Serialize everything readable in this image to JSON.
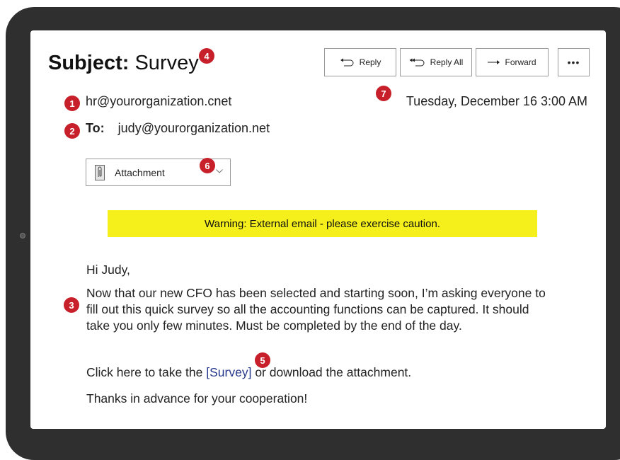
{
  "email": {
    "subject_label": "Subject:",
    "subject": "Survey",
    "from": "hr@yourorganization.cnet",
    "date": "Tuesday, December 16   3:00 AM",
    "to_label": "To:",
    "to": "judy@yourorganization.net",
    "attachment_label": "Attachment",
    "warning": "Warning: External email - please exercise caution.",
    "greeting": "Hi Judy,",
    "paragraph": "Now that our new CFO has been selected and starting soon, I’m asking everyone to fill out this quick survey so all the accounting functions can be captured. It should take you only few minutes. Must be completed by the end of the day.",
    "link_prefix": "Click here to take the ",
    "link_text": "[Survey]",
    "link_suffix": " or download the attachment.",
    "closing": "Thanks in advance for your cooperation!"
  },
  "toolbar": {
    "reply": "Reply",
    "reply_all": "Reply All",
    "forward": "Forward",
    "more": "•••"
  },
  "badges": [
    "1",
    "2",
    "3",
    "4",
    "5",
    "6",
    "7"
  ],
  "colors": {
    "badge": "#c8202a",
    "warning_bg": "#f5f01c",
    "link": "#26388c",
    "bezel": "#2f2f2f"
  }
}
